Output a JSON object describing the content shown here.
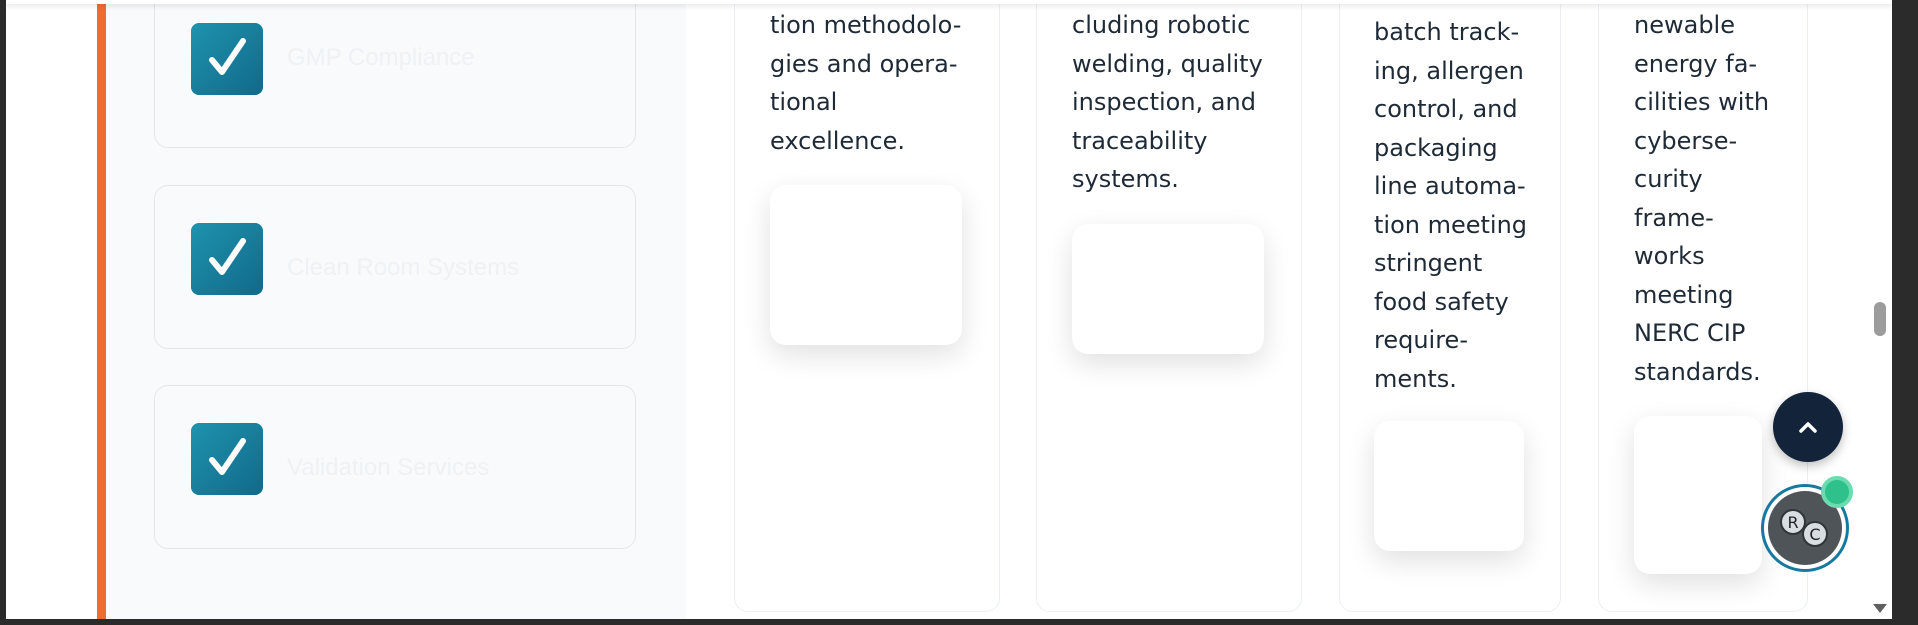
{
  "checklist": {
    "items": [
      {
        "label": "GMP Compliance"
      },
      {
        "label": "Clean Room Systems"
      },
      {
        "label": "Validation Services"
      }
    ]
  },
  "columns": [
    {
      "text": "tion methodolo-\ngies and opera-\ntional\nexcellence."
    },
    {
      "text": "cluding robotic\nwelding, quality\ninspection, and\ntraceability\nsystems."
    },
    {
      "text": "batch track-\ning, allergen\ncontrol, and\npackaging\nline automa-\ntion meeting\nstringent\nfood safety\nrequire-\nments."
    },
    {
      "text": "newable\nenergy fa-\ncilities with\ncyberse-\ncurity\nframe-\nworks\nmeeting\nNERC CIP\nstandards."
    }
  ],
  "widgets": {
    "scroll_top_icon": "chevron-up-icon",
    "chat_logo_letters": [
      "R",
      "C"
    ],
    "status": "online"
  },
  "colors": {
    "accent": "#f26a35",
    "check": "#167fa0",
    "dark_button": "#13233a",
    "online": "#2fc18b"
  }
}
